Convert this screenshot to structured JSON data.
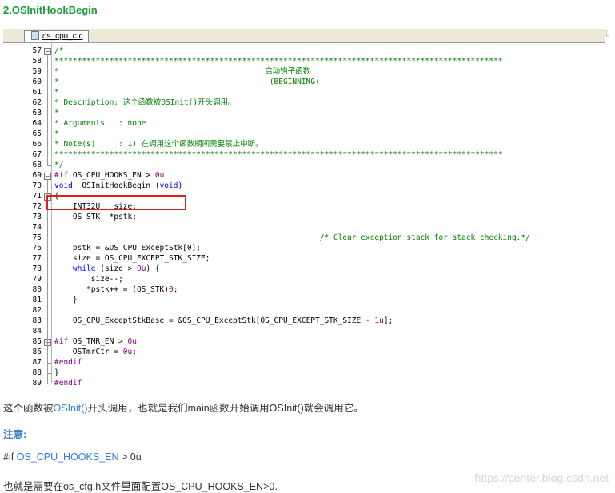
{
  "heading": "2.OSInitHookBegin",
  "editor": {
    "tab_label": "os_cpu_c.c",
    "lines": [
      {
        "num": "57",
        "fold": "minus",
        "segs": [
          [
            "comment",
            "/*"
          ]
        ]
      },
      {
        "num": "58",
        "fold": "",
        "segs": [
          [
            "comment",
            "**************************************************************************************************"
          ]
        ]
      },
      {
        "num": "59",
        "fold": "",
        "segs": [
          [
            "comment",
            "*                                             启动钩子函数"
          ]
        ]
      },
      {
        "num": "60",
        "fold": "",
        "segs": [
          [
            "comment",
            "*                                              (BEGINNING)"
          ]
        ]
      },
      {
        "num": "61",
        "fold": "",
        "segs": [
          [
            "comment",
            "*"
          ]
        ]
      },
      {
        "num": "62",
        "fold": "",
        "segs": [
          [
            "comment",
            "* Description: 这个函数被OSInit()开头调用。"
          ]
        ]
      },
      {
        "num": "63",
        "fold": "",
        "segs": [
          [
            "comment",
            "*"
          ]
        ]
      },
      {
        "num": "64",
        "fold": "",
        "segs": [
          [
            "comment",
            "* Arguments   : none"
          ]
        ]
      },
      {
        "num": "65",
        "fold": "",
        "segs": [
          [
            "comment",
            "*"
          ]
        ]
      },
      {
        "num": "66",
        "fold": "",
        "segs": [
          [
            "comment",
            "* Note(s)     : 1) 在调用这个函数期间需要禁止中断。"
          ]
        ]
      },
      {
        "num": "67",
        "fold": "",
        "segs": [
          [
            "comment",
            "**************************************************************************************************"
          ]
        ]
      },
      {
        "num": "68",
        "fold": "end",
        "segs": [
          [
            "comment",
            "*/"
          ]
        ]
      },
      {
        "num": "69",
        "fold": "minus",
        "segs": [
          [
            "pre",
            "#if "
          ],
          [
            "plain",
            "OS_CPU_HOOKS_EN > "
          ],
          [
            "num",
            "0u"
          ]
        ]
      },
      {
        "num": "70",
        "fold": "",
        "segs": [
          [
            "kw",
            "void"
          ],
          [
            "plain",
            "  OSInitHookBegin ("
          ],
          [
            "kw",
            "void"
          ],
          [
            "plain",
            ")"
          ]
        ]
      },
      {
        "num": "71",
        "fold": "minus",
        "segs": [
          [
            "plain",
            "{"
          ]
        ]
      },
      {
        "num": "72",
        "fold": "",
        "segs": [
          [
            "plain",
            "    INT32U   size;"
          ]
        ]
      },
      {
        "num": "73",
        "fold": "",
        "segs": [
          [
            "plain",
            "    OS_STK  *pstk;"
          ]
        ]
      },
      {
        "num": "74",
        "fold": "",
        "segs": [
          [
            "plain",
            ""
          ]
        ]
      },
      {
        "num": "75",
        "fold": "",
        "segs": [
          [
            "plain",
            "                                                          "
          ],
          [
            "comment",
            "/* Clear exception stack for stack checking.*/"
          ]
        ]
      },
      {
        "num": "76",
        "fold": "",
        "segs": [
          [
            "plain",
            "    pstk = &OS_CPU_ExceptStk[0];"
          ]
        ]
      },
      {
        "num": "77",
        "fold": "",
        "segs": [
          [
            "plain",
            "    size = OS_CPU_EXCEPT_STK_SIZE;"
          ]
        ]
      },
      {
        "num": "78",
        "fold": "",
        "segs": [
          [
            "plain",
            "    "
          ],
          [
            "kw",
            "while"
          ],
          [
            "plain",
            " (size > "
          ],
          [
            "num",
            "0u"
          ],
          [
            "plain",
            ") {"
          ]
        ]
      },
      {
        "num": "79",
        "fold": "",
        "segs": [
          [
            "plain",
            "        size--;"
          ]
        ]
      },
      {
        "num": "80",
        "fold": "",
        "segs": [
          [
            "plain",
            "       *pstk++ = (OS_STK)"
          ],
          [
            "num",
            "0"
          ],
          [
            "plain",
            ";"
          ]
        ]
      },
      {
        "num": "81",
        "fold": "",
        "segs": [
          [
            "plain",
            "    }"
          ]
        ]
      },
      {
        "num": "82",
        "fold": "",
        "segs": [
          [
            "plain",
            ""
          ]
        ]
      },
      {
        "num": "83",
        "fold": "",
        "segs": [
          [
            "plain",
            "    OS_CPU_ExceptStkBase = &OS_CPU_ExceptStk[OS_CPU_EXCEPT_STK_SIZE - "
          ],
          [
            "num",
            "1u"
          ],
          [
            "plain",
            "];"
          ]
        ]
      },
      {
        "num": "84",
        "fold": "",
        "segs": [
          [
            "plain",
            ""
          ]
        ]
      },
      {
        "num": "85",
        "fold": "minus",
        "segs": [
          [
            "pre",
            "#if "
          ],
          [
            "plain",
            "OS_TMR_EN > "
          ],
          [
            "num",
            "0u"
          ]
        ]
      },
      {
        "num": "86",
        "fold": "",
        "segs": [
          [
            "plain",
            "    OSTmrCtr = "
          ],
          [
            "num",
            "0u"
          ],
          [
            "plain",
            ";"
          ]
        ]
      },
      {
        "num": "87",
        "fold": "end",
        "segs": [
          [
            "pre",
            "#endif"
          ]
        ]
      },
      {
        "num": "88",
        "fold": "end",
        "segs": [
          [
            "plain",
            "}"
          ]
        ]
      },
      {
        "num": "89",
        "fold": "",
        "segs": [
          [
            "pre",
            "#endif"
          ]
        ]
      }
    ]
  },
  "para1": {
    "before": "这个函数被",
    "link": "OSInit()",
    "after": "开头调用，也就是我们main函数开始调用OSInit()就会调用它。"
  },
  "note_label": "注意:",
  "para2": {
    "prefix": "#if ",
    "link": "OS_CPU_HOOKS_EN",
    "suffix": " > 0u"
  },
  "para3": "也就是需要在os_cfg.h文件里面配置OS_CPU_HOOKS_EN>0.",
  "watermark": "https://center.blog.csdn.net",
  "colors": {
    "heading": "#1a9a3a",
    "comment": "#008000",
    "keyword": "#0000ff",
    "preprocessor": "#7f007f",
    "number": "#800080",
    "link": "#2f7fd8",
    "highlight_box": "#e0201d"
  }
}
